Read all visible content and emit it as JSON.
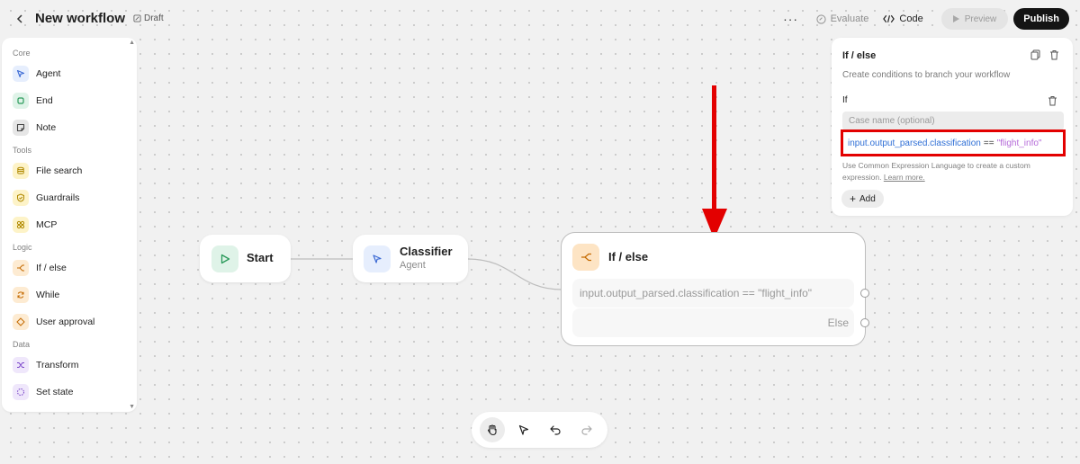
{
  "topbar": {
    "title": "New workflow",
    "status": "Draft",
    "more": "···",
    "evaluate": "Evaluate",
    "code": "Code",
    "preview": "Preview",
    "publish": "Publish"
  },
  "sidebar": {
    "sections": [
      {
        "label": "Core",
        "items": [
          {
            "label": "Agent",
            "icon": "agent-icon",
            "color": "#e6eefd"
          },
          {
            "label": "End",
            "icon": "end-icon",
            "color": "#dff3e8"
          },
          {
            "label": "Note",
            "icon": "note-icon",
            "color": "#e6e6e6"
          }
        ]
      },
      {
        "label": "Tools",
        "items": [
          {
            "label": "File search",
            "icon": "file-search-icon",
            "color": "#fdf3c8"
          },
          {
            "label": "Guardrails",
            "icon": "guardrails-icon",
            "color": "#fdf3c8"
          },
          {
            "label": "MCP",
            "icon": "mcp-icon",
            "color": "#fdf3c8"
          }
        ]
      },
      {
        "label": "Logic",
        "items": [
          {
            "label": "If / else",
            "icon": "if-else-icon",
            "color": "#fdebd2"
          },
          {
            "label": "While",
            "icon": "while-icon",
            "color": "#fdebd2"
          },
          {
            "label": "User approval",
            "icon": "user-approval-icon",
            "color": "#fdebd2"
          }
        ]
      },
      {
        "label": "Data",
        "items": [
          {
            "label": "Transform",
            "icon": "transform-icon",
            "color": "#efe7fb"
          },
          {
            "label": "Set state",
            "icon": "set-state-icon",
            "color": "#efe7fb"
          }
        ]
      }
    ]
  },
  "canvas": {
    "start": {
      "label": "Start",
      "color": "#dff3e8"
    },
    "classifier": {
      "label": "Classifier",
      "sublabel": "Agent",
      "color": "#e6eefd"
    },
    "ifelse": {
      "label": "If / else",
      "color": "#fde4c4",
      "condition": "input.output_parsed.classification == \"flight_info\"",
      "else_label": "Else"
    }
  },
  "panel": {
    "title": "If / else",
    "description": "Create conditions to branch your workflow",
    "if_label": "If",
    "case_placeholder": "Case name (optional)",
    "expression_var": "input.output_parsed.classification",
    "expression_op": "==",
    "expression_value": "\"flight_info\"",
    "help_text": "Use Common Expression Language to create a custom expression.",
    "learn_more": "Learn more.",
    "add_label": "Add",
    "colors": {
      "var": "#2f6fd6",
      "value": "#b56ad9",
      "highlight": "#e30000"
    }
  },
  "toolbar": {
    "tools": [
      "pan-hand-icon",
      "pointer-icon",
      "undo-icon",
      "redo-icon"
    ]
  }
}
